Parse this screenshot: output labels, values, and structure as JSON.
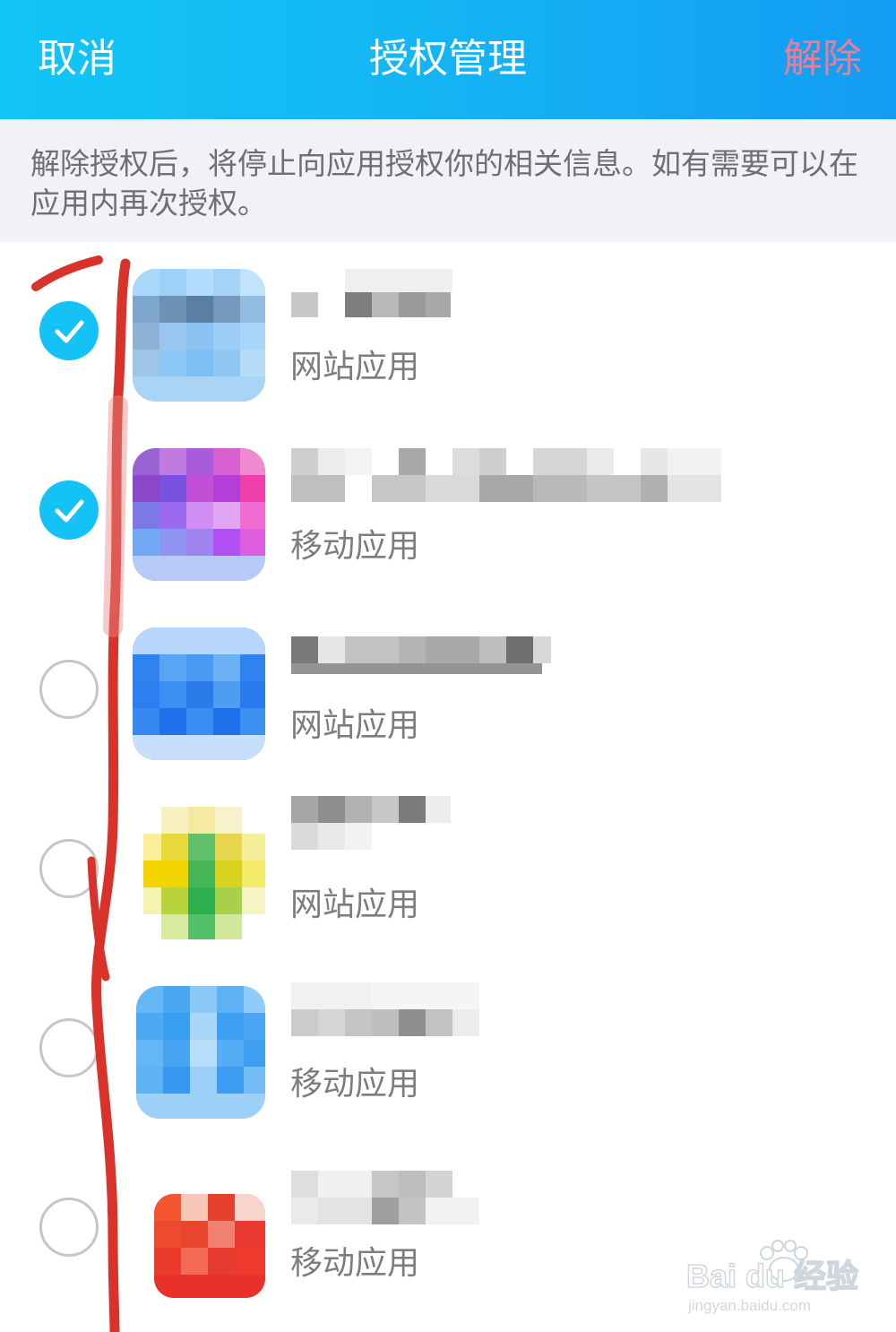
{
  "header": {
    "cancel_label": "取消",
    "title": "授权管理",
    "revoke_label": "解除"
  },
  "notice": {
    "text": "解除授权后，将停止向应用授权你的相关信息。如有需要可以在应用内再次授权。"
  },
  "apps": [
    {
      "type": "网站应用",
      "selected": true
    },
    {
      "type": "移动应用",
      "selected": true
    },
    {
      "type": "网站应用",
      "selected": false
    },
    {
      "type": "网站应用",
      "selected": false
    },
    {
      "type": "移动应用",
      "selected": false
    },
    {
      "type": "移动应用",
      "selected": false
    }
  ],
  "watermark": {
    "brand": "Bai du 经验",
    "url": "jingyan.baidu.com"
  },
  "colors": {
    "header_gradient_start": "#12c6f5",
    "header_gradient_end": "#139cf3",
    "revoke_text": "#f07a94",
    "check_selected": "#15c2f6",
    "annotation_red": "#d8322b"
  }
}
